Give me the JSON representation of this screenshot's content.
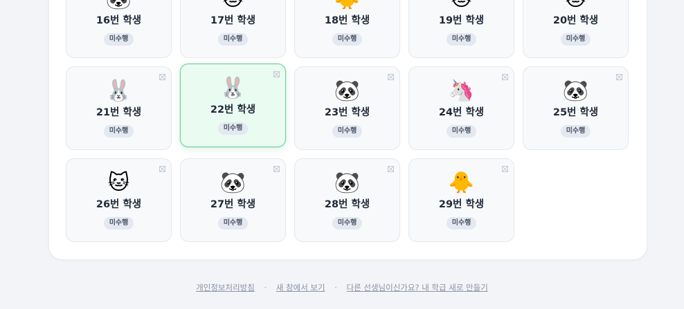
{
  "students": [
    {
      "label": "16번 학생",
      "animal": "🐼",
      "status": "미수행"
    },
    {
      "label": "17번 학생",
      "animal": "🐱",
      "status": "미수행"
    },
    {
      "label": "18번 학생",
      "animal": "🐥",
      "status": "미수행"
    },
    {
      "label": "19번 학생",
      "animal": "🐱",
      "status": "미수행"
    },
    {
      "label": "20번 학생",
      "animal": "🐱",
      "status": "미수행"
    },
    {
      "label": "21번 학생",
      "animal": "🐰",
      "status": "미수행"
    },
    {
      "label": "22번 학생",
      "animal": "🐰",
      "status": "미수행",
      "selected": true
    },
    {
      "label": "23번 학생",
      "animal": "🐼",
      "status": "미수행"
    },
    {
      "label": "24번 학생",
      "animal": "🦄",
      "status": "미수행"
    },
    {
      "label": "25번 학생",
      "animal": "🐼",
      "status": "미수행"
    },
    {
      "label": "26번 학생",
      "animal": "🐱",
      "status": "미수행"
    },
    {
      "label": "27번 학생",
      "animal": "🐼",
      "status": "미수행"
    },
    {
      "label": "28번 학생",
      "animal": "🐼",
      "status": "미수행"
    },
    {
      "label": "29번 학생",
      "animal": "🐥",
      "status": "미수행"
    }
  ],
  "footer": {
    "privacy": "개인정보처리방침",
    "new_window": "새 창에서 보기",
    "create_class": "다른 선생님이신가요? 내 학급 새로 만들기",
    "separator": "·"
  },
  "colors": {
    "selected_border": "#6fd49a",
    "selected_bg": "#eafbf1",
    "badge_bg": "#e3e8f1"
  }
}
